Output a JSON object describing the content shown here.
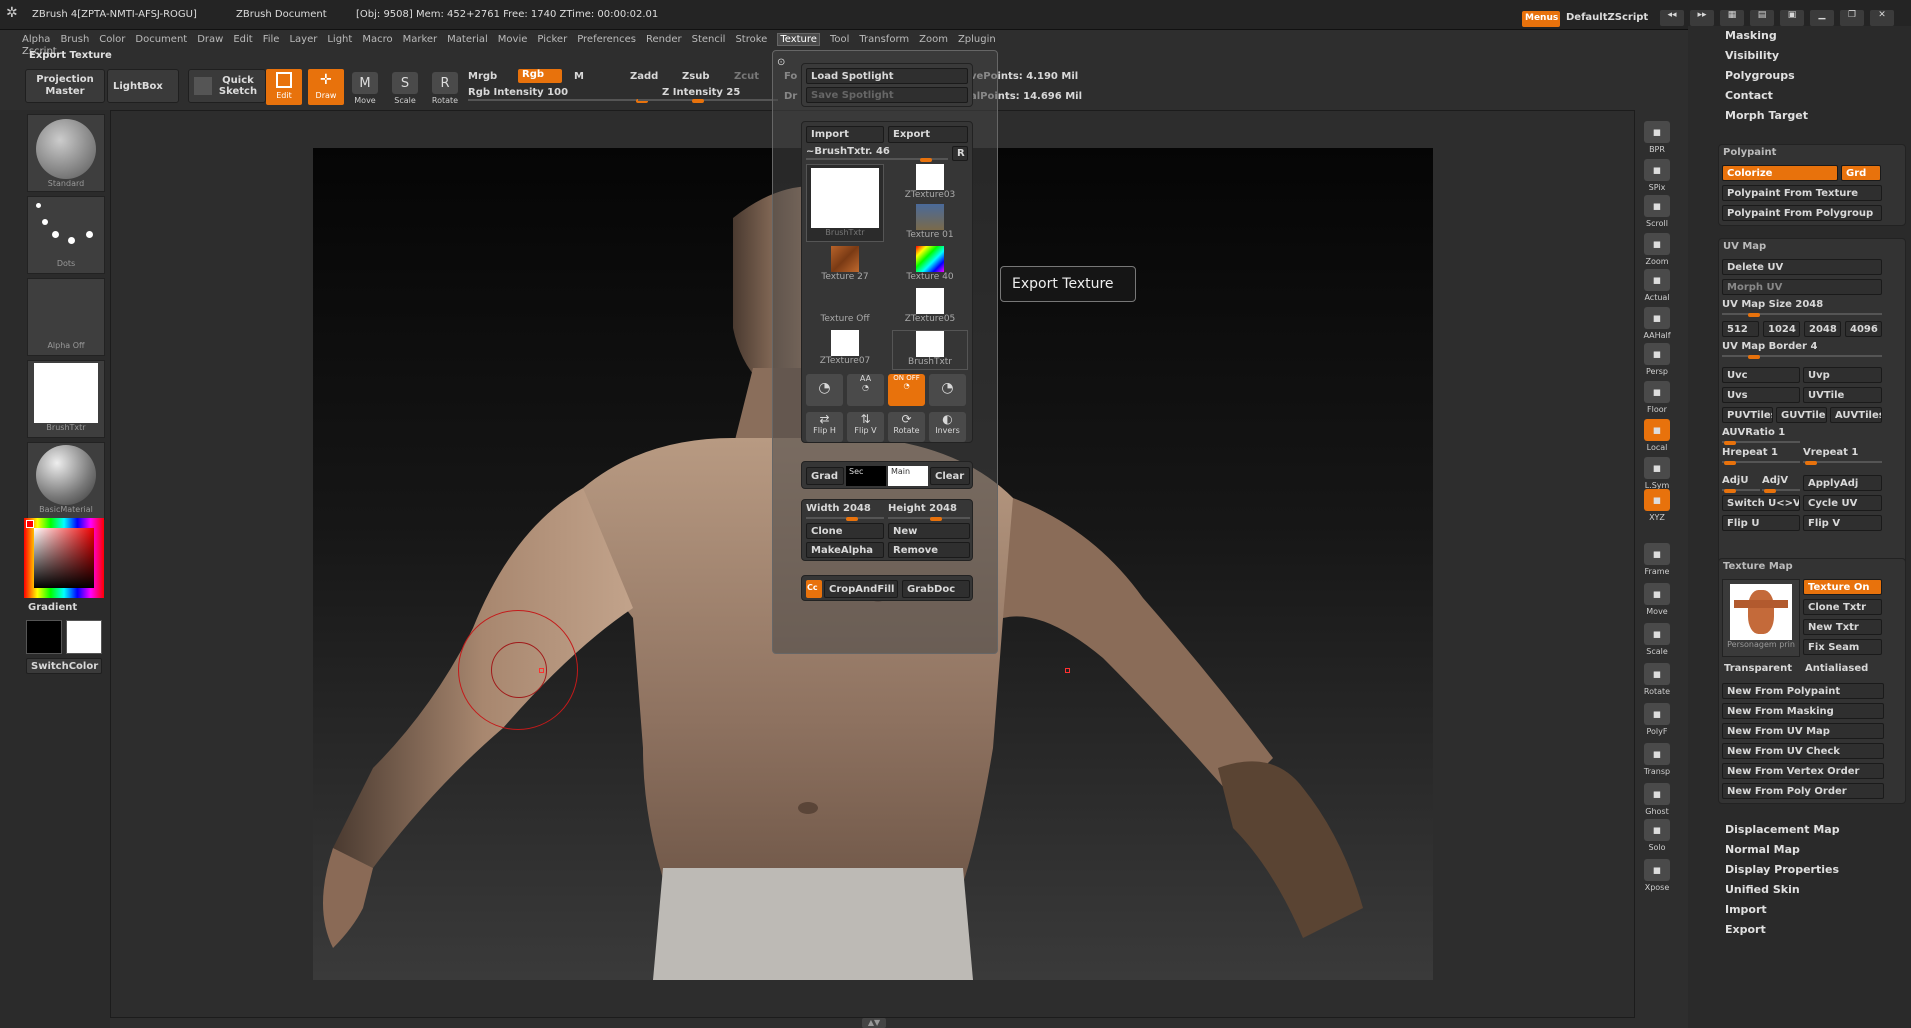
{
  "titlebar": {
    "app": "ZBrush 4[ZPTA-NMTI-AFSJ-ROGU]",
    "doc": "ZBrush Document",
    "stats": "[Obj: 9508] Mem: 452+2761 Free: 1740 ZTime: 00:00:02.01",
    "menus_btn": "Menus",
    "script": "DefaultZScript"
  },
  "menubar": [
    "Alpha",
    "Brush",
    "Color",
    "Document",
    "Draw",
    "Edit",
    "File",
    "Layer",
    "Light",
    "Macro",
    "Marker",
    "Material",
    "Movie",
    "Picker",
    "Preferences",
    "Render",
    "Stencil",
    "Stroke",
    "Texture",
    "Tool",
    "Transform",
    "Zoom",
    "Zplugin",
    "Zscript"
  ],
  "active_menu": "Texture",
  "toolbar": {
    "status": "Export Texture",
    "projection_master": "Projection Master",
    "lightbox": "LightBox",
    "quick_sketch": "Quick Sketch",
    "edit": "Edit",
    "draw": "Draw",
    "move": "Move",
    "scale": "Scale",
    "rotate": "Rotate",
    "mrgb": "Mrgb",
    "rgb": "Rgb",
    "m": "M",
    "rgb_intensity": "Rgb Intensity 100",
    "zadd": "Zadd",
    "zsub": "Zsub",
    "zcut": "Zcut",
    "z_intensity": "Z Intensity 25",
    "fo": "Fo",
    "dr": "Dr",
    "active_points": "vePoints: 4.190 Mil",
    "total_points": "alPoints: 14.696 Mil"
  },
  "left_shelf": {
    "brush": "Standard",
    "stroke": "Dots",
    "alpha": "Alpha  Off",
    "texture": "BrushTxtr",
    "material": "BasicMaterial",
    "gradient": "Gradient",
    "switch_color": "SwitchColor"
  },
  "texture_menu": {
    "load_spotlight": "Load Spotlight",
    "save_spotlight": "Save Spotlight",
    "import": "Import",
    "export": "Export",
    "brush_txtr": "~BrushTxtr. 46",
    "r": "R",
    "thumbs": [
      "BrushTxtr",
      "ZTexture03",
      "Texture 01",
      "Texture 27",
      "Texture 40",
      "Texture  Off",
      "ZTexture05",
      "ZTexture07",
      "BrushTxtr"
    ],
    "mode_labels": [
      "AA",
      "ON OFF"
    ],
    "flip_h": "Flip H",
    "flip_v": "Flip V",
    "rotate": "Rotate",
    "invers": "Invers",
    "grad": "Grad",
    "sec": "Sec",
    "main": "Main",
    "clear": "Clear",
    "width": "Width 2048",
    "height": "Height 2048",
    "clone": "Clone",
    "new": "New",
    "make_alpha": "MakeAlpha",
    "remove": "Remove",
    "cc": "Cc",
    "crop_and_fill": "CropAndFill",
    "grab_doc": "GrabDoc"
  },
  "tooltip": "Export Texture",
  "right_tools": [
    "BPR",
    "SPix",
    "Scroll",
    "Zoom",
    "Actual",
    "AAHalf",
    "Persp",
    "Floor",
    "Local",
    "L.Sym",
    "XYZ",
    "Frame",
    "Move",
    "Scale",
    "Rotate",
    "PolyF",
    "Transp",
    "Ghost",
    "Solo",
    "Xpose"
  ],
  "tool_palette": {
    "top_items": [
      "Masking",
      "Visibility",
      "Polygroups",
      "Contact",
      "Morph Target"
    ],
    "polypaint_title": "Polypaint",
    "colorize": "Colorize",
    "grd": "Grd",
    "pp_from_texture": "Polypaint From Texture",
    "pp_from_polygroup": "Polypaint From Polygroup",
    "uvmap_title": "UV Map",
    "delete_uv": "Delete UV",
    "morph_uv": "Morph UV",
    "uv_map_size": "UV Map Size 2048",
    "sizes": [
      "512",
      "1024",
      "2048",
      "4096"
    ],
    "uv_map_border": "UV Map Border 4",
    "uvc": "Uvc",
    "uvp": "Uvp",
    "uvs": "Uvs",
    "uvtile": "UVTile",
    "puvtiles": "PUVTiles",
    "guvtiles": "GUVTiles",
    "auvtiles": "AUVTiles",
    "auvratio": "AUVRatio 1",
    "hrepeat": "Hrepeat 1",
    "vrepeat": "Vrepeat 1",
    "adju": "AdjU",
    "adjv": "AdjV",
    "applyadj": "ApplyAdj",
    "switch_uv": "Switch U<>V",
    "cycle_uv": "Cycle UV",
    "flip_u": "Flip U",
    "flip_v": "Flip V",
    "texture_map_title": "Texture Map",
    "texture_on": "Texture On",
    "clone_txtr": "Clone Txtr",
    "new_txtr": "New Txtr",
    "fix_seam": "Fix Seam",
    "thumb_label": "Personagem prin",
    "transparent": "Transparent",
    "antialiased": "Antialiased",
    "new_from": [
      "New From Polypaint",
      "New From Masking",
      "New From UV Map",
      "New From UV Check",
      "New From Vertex Order",
      "New From Poly Order"
    ],
    "bottom_items": [
      "Displacement Map",
      "Normal Map",
      "Display Properties",
      "Unified Skin",
      "Import",
      "Export"
    ]
  },
  "colors": {
    "accent": "#e8720c",
    "bg": "#2e2e2e",
    "panel": "#3b3b3b"
  }
}
